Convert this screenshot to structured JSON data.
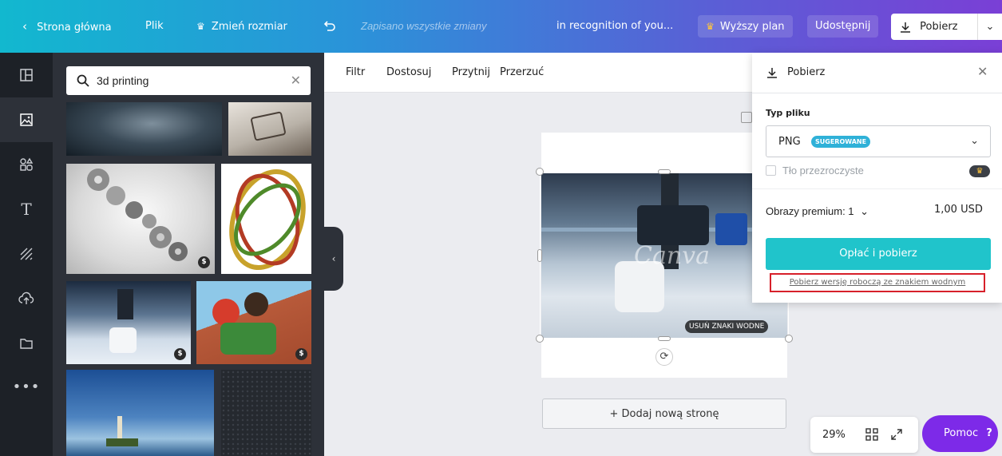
{
  "topbar": {
    "home": "Strona główna",
    "file": "Plik",
    "resize": "Zmień rozmiar",
    "saved": "Zapisano wszystkie zmiany",
    "doc_title": "in recognition of you...",
    "upgrade": "Wyższy plan",
    "share": "Udostępnij",
    "download": "Pobierz"
  },
  "search": {
    "value": "3d printing"
  },
  "toolbar": {
    "filter": "Filtr",
    "adjust": "Dostosuj",
    "crop": "Przytnij",
    "flip": "Przerzuć"
  },
  "panel": {
    "badge": "$"
  },
  "canvas": {
    "watermark": "Canva",
    "remove_watermarks": "USUŃ ZNAKI WODNE",
    "add_page": "+ Dodaj nową stronę",
    "zoom": "29%"
  },
  "help": {
    "label": "Pomoc",
    "icon": "?"
  },
  "download_panel": {
    "title": "Pobierz",
    "file_type_label": "Typ pliku",
    "file_type": "PNG",
    "suggested": "SUGEROWANE",
    "transparent": "Tło przezroczyste",
    "premium_label": "Obrazy premium: 1",
    "price": "1,00 USD",
    "pay_button": "Opłać i pobierz",
    "watermark_link": "Pobierz wersję roboczą ze znakiem wodnym"
  },
  "colors": {
    "accent": "#20c4cb",
    "help": "#7d2ae8",
    "highlight": "#d7202a",
    "rail": "#1d2127"
  }
}
